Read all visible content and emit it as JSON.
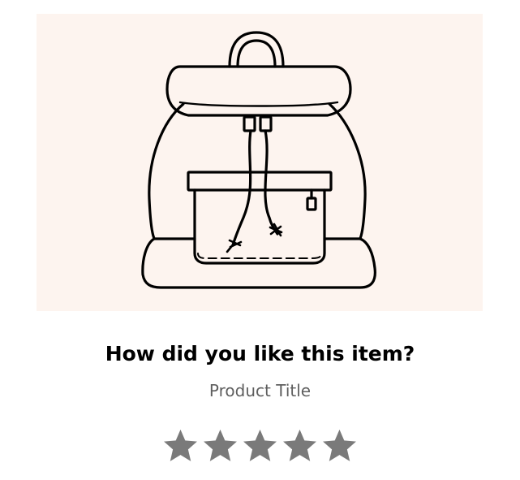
{
  "product": {
    "image_icon": "backpack-icon",
    "image_background": "#fdf4ef",
    "question": "How did you like this item?",
    "title": "Product Title"
  },
  "rating": {
    "max_stars": 5,
    "selected": 0,
    "star_icon": "star-icon",
    "star_color": "#7a7a7a"
  }
}
